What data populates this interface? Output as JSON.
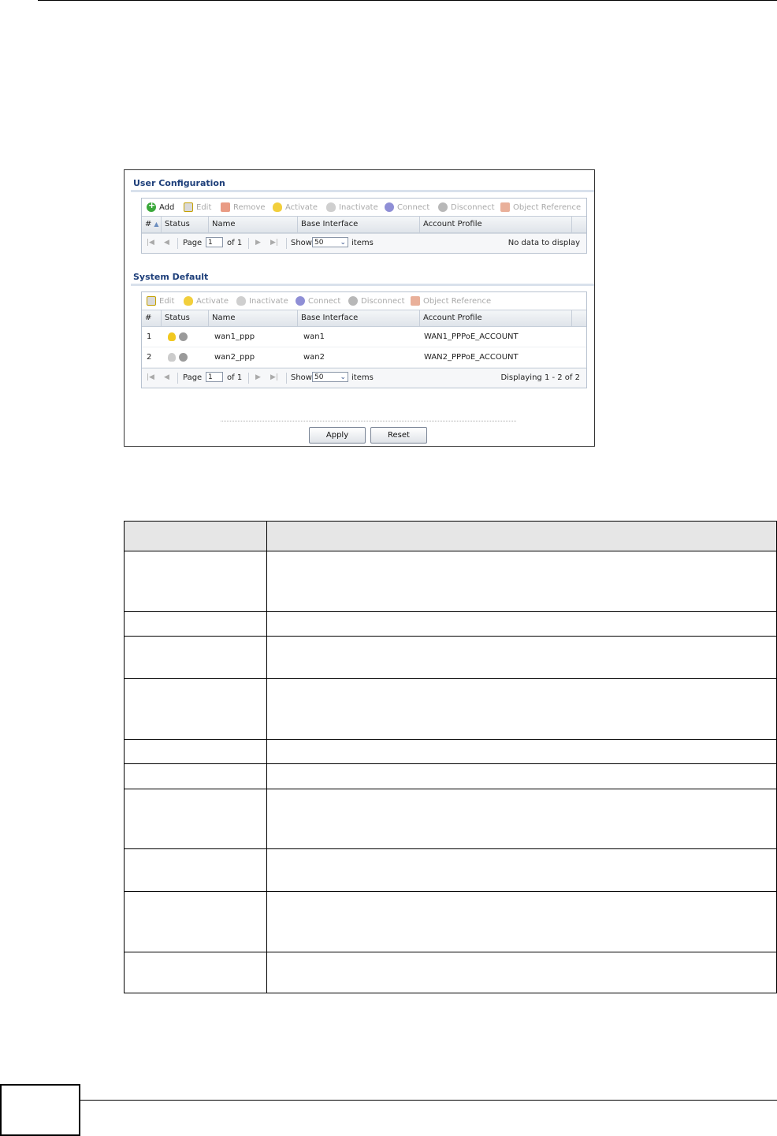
{
  "user_config": {
    "title": "User Configuration",
    "toolbar": {
      "add": "Add",
      "edit": "Edit",
      "remove": "Remove",
      "activate": "Activate",
      "inactivate": "Inactivate",
      "connect": "Connect",
      "disconnect": "Disconnect",
      "object_reference": "Object Reference"
    },
    "columns": {
      "num": "#",
      "status": "Status",
      "name": "Name",
      "base_interface": "Base Interface",
      "account_profile": "Account Profile"
    },
    "pager": {
      "page_label": "Page",
      "page_value": "1",
      "of_label": "of 1",
      "show_label": "Show",
      "show_value": "50",
      "items_label": "items",
      "status_text": "No data to display"
    }
  },
  "system_default": {
    "title": "System Default",
    "toolbar": {
      "edit": "Edit",
      "activate": "Activate",
      "inactivate": "Inactivate",
      "connect": "Connect",
      "disconnect": "Disconnect",
      "object_reference": "Object Reference"
    },
    "columns": {
      "num": "#",
      "status": "Status",
      "name": "Name",
      "base_interface": "Base Interface",
      "account_profile": "Account Profile"
    },
    "rows": [
      {
        "num": "1",
        "status": "active",
        "name": "wan1_ppp",
        "base_interface": "wan1",
        "account_profile": "WAN1_PPPoE_ACCOUNT"
      },
      {
        "num": "2",
        "status": "inactive",
        "name": "wan2_ppp",
        "base_interface": "wan2",
        "account_profile": "WAN2_PPPoE_ACCOUNT"
      }
    ],
    "pager": {
      "page_label": "Page",
      "page_value": "1",
      "of_label": "of 1",
      "show_label": "Show",
      "show_value": "50",
      "items_label": "items",
      "status_text": "Displaying 1 - 2 of 2"
    }
  },
  "buttons": {
    "apply": "Apply",
    "reset": "Reset"
  },
  "colors": {
    "section_title": "#1e3f7a",
    "bulb_on": "#f1c81f",
    "add_icon": "#3aa83a"
  }
}
